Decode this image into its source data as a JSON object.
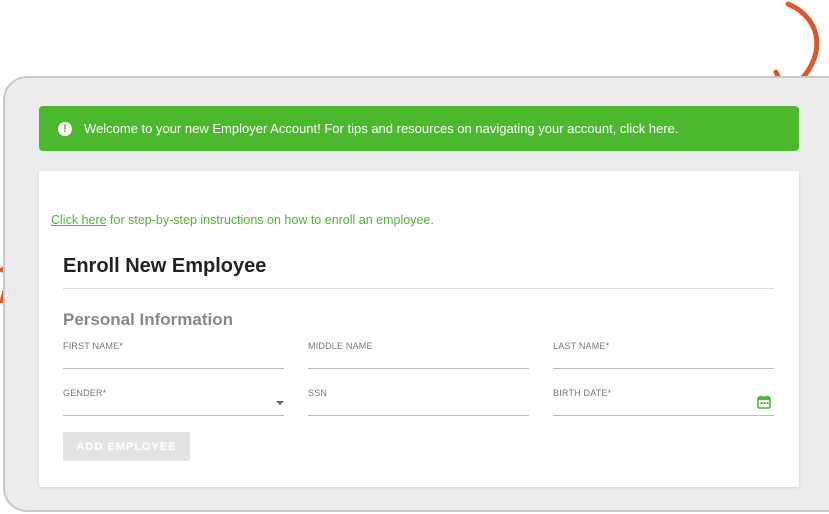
{
  "banner": {
    "text": "Welcome to your new Employer Account! For tips and resources on navigating your account, click here.",
    "icon": "alert-circle-icon"
  },
  "help": {
    "link_text": "Click here",
    "rest_text": " for step-by-step instructions on how to enroll an employee."
  },
  "form": {
    "title": "Enroll New Employee",
    "section_title": "Personal Information",
    "fields": {
      "first_name": "FIRST NAME*",
      "middle_name": "MIDDLE NAME",
      "last_name": "LAST NAME*",
      "gender": "GENDER*",
      "ssn": "SSN",
      "birth_date": "BIRTH DATE*"
    },
    "submit_label": "ADD EMPLOYEE"
  },
  "colors": {
    "accent": "#4cb82e",
    "arrow": "#e0562a"
  }
}
